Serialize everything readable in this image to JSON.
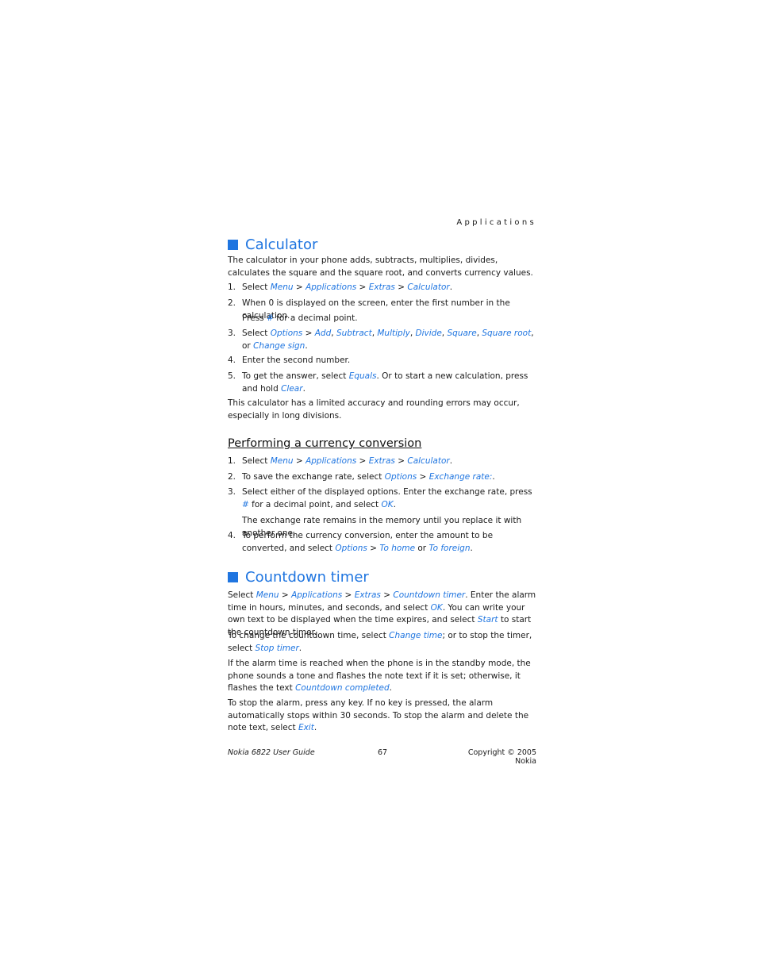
{
  "running_head": "Applications",
  "calculator": {
    "title": "Calculator",
    "intro": "The calculator in your phone adds, subtracts, multiplies, divides, calculates the square and the square root, and converts currency values.",
    "steps": [
      {
        "num": "1.",
        "parts": [
          "Select ",
          "Menu",
          " > ",
          "Applications",
          " > ",
          "Extras",
          " > ",
          "Calculator",
          "."
        ]
      },
      {
        "num": "2.",
        "text": "When 0 is displayed on the screen, enter the first number in the calculation.",
        "sub": [
          "Press ",
          "#",
          " for a decimal point."
        ]
      },
      {
        "num": "3.",
        "parts": [
          "Select ",
          "Options",
          " > ",
          "Add",
          ", ",
          "Subtract",
          ", ",
          "Multiply",
          ", ",
          "Divide",
          ", ",
          "Square",
          ", ",
          "Square root",
          ", or ",
          "Change sign",
          "."
        ]
      },
      {
        "num": "4.",
        "text": "Enter the second number."
      },
      {
        "num": "5.",
        "parts": [
          "To get the answer, select ",
          "Equals",
          ". Or to start a new calculation, press and hold ",
          "Clear",
          "."
        ]
      }
    ],
    "note": "This calculator has a limited accuracy and rounding errors may occur, especially in long divisions."
  },
  "currency": {
    "title": "Performing a currency conversion",
    "steps": [
      {
        "num": "1.",
        "parts": [
          "Select ",
          "Menu",
          " > ",
          "Applications",
          " > ",
          "Extras",
          " > ",
          "Calculator",
          "."
        ]
      },
      {
        "num": "2.",
        "parts": [
          "To save the exchange rate, select ",
          "Options",
          " > ",
          "Exchange rate:",
          "."
        ]
      },
      {
        "num": "3.",
        "parts": [
          "Select either of the displayed options. Enter the exchange rate, press ",
          "#",
          " for a decimal point, and select ",
          "OK",
          "."
        ],
        "sub_text": "The exchange rate remains in the memory until you replace it with another one."
      },
      {
        "num": "4.",
        "parts": [
          "To perform the currency conversion, enter the amount to be converted, and select ",
          "Options",
          " > ",
          "To home",
          " or ",
          "To foreign",
          "."
        ]
      }
    ]
  },
  "countdown": {
    "title": "Countdown timer",
    "p1": [
      "Select ",
      "Menu",
      " > ",
      "Applications",
      " > ",
      "Extras",
      " > ",
      "Countdown timer",
      ". Enter the alarm time in hours, minutes, and seconds, and select ",
      "OK",
      ". You can write your own text to be displayed when the time expires, and select ",
      "Start",
      " to start the countdown timer."
    ],
    "p2": [
      "To change the countdown time, select ",
      "Change time",
      "; or to stop the timer, select ",
      "Stop timer",
      "."
    ],
    "p3": [
      "If the alarm time is reached when the phone is in the standby mode, the phone sounds a tone and flashes the note text if it is set; otherwise, it flashes the text ",
      "Countdown completed",
      "."
    ],
    "p4": [
      "To stop the alarm, press any key. If no key is pressed, the alarm automatically stops within 30 seconds. To stop the alarm and delete the note text, select ",
      "Exit",
      "."
    ]
  },
  "footer": {
    "guide": "Nokia 6822 User Guide",
    "page": "67",
    "copyright": "Copyright © 2005 Nokia"
  }
}
